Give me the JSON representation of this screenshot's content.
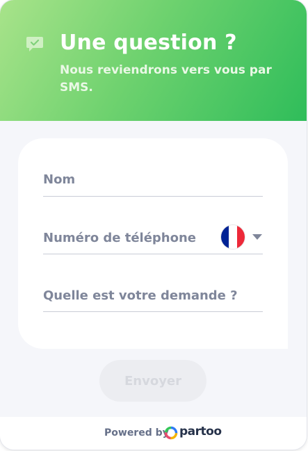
{
  "header": {
    "title": "Une question ?",
    "subtitle": "Nous reviendrons vers vous par SMS.",
    "icon": "chat-check-icon"
  },
  "form": {
    "name_label": "Nom",
    "phone_label": "Numéro de téléphone",
    "request_label": "Quelle est votre demande ?",
    "country_flag": "flag-fr-icon"
  },
  "submit": {
    "label": "Envoyer"
  },
  "footer": {
    "powered_by": "Powered by",
    "brand": "partoo"
  },
  "colors": {
    "header_gradient_start": "#a8e38a",
    "header_gradient_end": "#2fbd5a",
    "label": "#7f869a",
    "button_disabled_bg": "#ecedf1",
    "button_disabled_text": "#d6d8de",
    "flag_blue": "#002395",
    "flag_white": "#ffffff",
    "flag_red": "#ed2939"
  }
}
